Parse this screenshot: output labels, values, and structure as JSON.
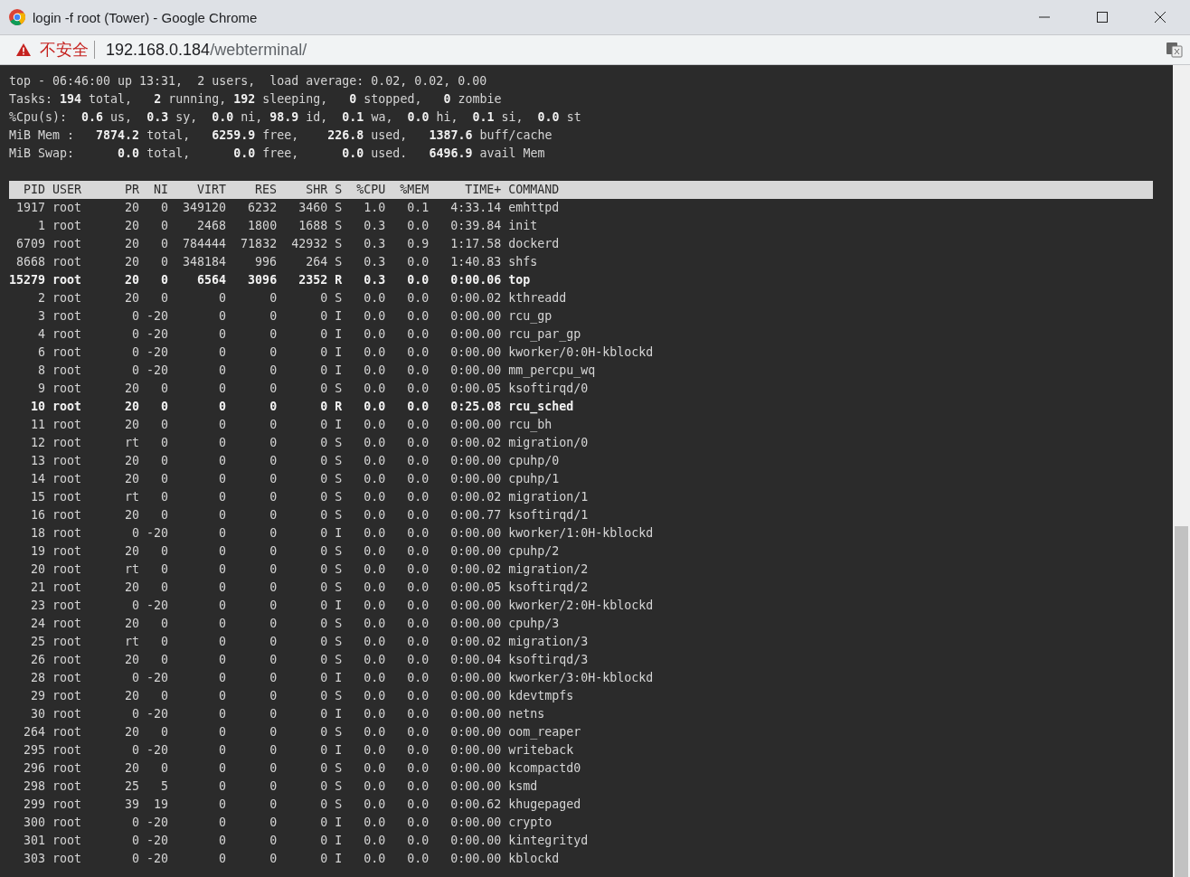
{
  "window": {
    "title": "login -f root (Tower) - Google Chrome"
  },
  "address_bar": {
    "security_label": "不安全",
    "host": "192.168.0.184",
    "path": "/webterminal/"
  },
  "terminal": {
    "summary": [
      "top - 06:46:00 up 13:31,  2 users,  load average: 0.02, 0.02, 0.00",
      "Tasks: **194** total,   **2** running, **192** sleeping,   **0** stopped,   **0** zombie",
      "%Cpu(s):  **0.6** us,  **0.3** sy,  **0.0** ni, **98.9** id,  **0.1** wa,  **0.0** hi,  **0.1** si,  **0.0** st",
      "MiB Mem :   **7874.2** total,   **6259.9** free,    **226.8** used,   **1387.6** buff/cache",
      "MiB Swap:      **0.0** total,      **0.0** free,      **0.0** used.   **6496.9** avail Mem"
    ],
    "columns": [
      "PID",
      "USER",
      "PR",
      "NI",
      "VIRT",
      "RES",
      "SHR",
      "S",
      "%CPU",
      "%MEM",
      "TIME+",
      "COMMAND"
    ],
    "processes": [
      {
        "cells": [
          "1917",
          "root",
          "20",
          "0",
          "349120",
          "6232",
          "3460",
          "S",
          "1.0",
          "0.1",
          "4:33.14",
          "emhttpd"
        ],
        "highlighted": false
      },
      {
        "cells": [
          "1",
          "root",
          "20",
          "0",
          "2468",
          "1800",
          "1688",
          "S",
          "0.3",
          "0.0",
          "0:39.84",
          "init"
        ],
        "highlighted": false
      },
      {
        "cells": [
          "6709",
          "root",
          "20",
          "0",
          "784444",
          "71832",
          "42932",
          "S",
          "0.3",
          "0.9",
          "1:17.58",
          "dockerd"
        ],
        "highlighted": false
      },
      {
        "cells": [
          "8668",
          "root",
          "20",
          "0",
          "348184",
          "996",
          "264",
          "S",
          "0.3",
          "0.0",
          "1:40.83",
          "shfs"
        ],
        "highlighted": false
      },
      {
        "cells": [
          "15279",
          "root",
          "20",
          "0",
          "6564",
          "3096",
          "2352",
          "R",
          "0.3",
          "0.0",
          "0:00.06",
          "top"
        ],
        "highlighted": true
      },
      {
        "cells": [
          "2",
          "root",
          "20",
          "0",
          "0",
          "0",
          "0",
          "S",
          "0.0",
          "0.0",
          "0:00.02",
          "kthreadd"
        ],
        "highlighted": false
      },
      {
        "cells": [
          "3",
          "root",
          "0",
          "-20",
          "0",
          "0",
          "0",
          "I",
          "0.0",
          "0.0",
          "0:00.00",
          "rcu_gp"
        ],
        "highlighted": false
      },
      {
        "cells": [
          "4",
          "root",
          "0",
          "-20",
          "0",
          "0",
          "0",
          "I",
          "0.0",
          "0.0",
          "0:00.00",
          "rcu_par_gp"
        ],
        "highlighted": false
      },
      {
        "cells": [
          "6",
          "root",
          "0",
          "-20",
          "0",
          "0",
          "0",
          "I",
          "0.0",
          "0.0",
          "0:00.00",
          "kworker/0:0H-kblockd"
        ],
        "highlighted": false
      },
      {
        "cells": [
          "8",
          "root",
          "0",
          "-20",
          "0",
          "0",
          "0",
          "I",
          "0.0",
          "0.0",
          "0:00.00",
          "mm_percpu_wq"
        ],
        "highlighted": false
      },
      {
        "cells": [
          "9",
          "root",
          "20",
          "0",
          "0",
          "0",
          "0",
          "S",
          "0.0",
          "0.0",
          "0:00.05",
          "ksoftirqd/0"
        ],
        "highlighted": false
      },
      {
        "cells": [
          "10",
          "root",
          "20",
          "0",
          "0",
          "0",
          "0",
          "R",
          "0.0",
          "0.0",
          "0:25.08",
          "rcu_sched"
        ],
        "highlighted": true
      },
      {
        "cells": [
          "11",
          "root",
          "20",
          "0",
          "0",
          "0",
          "0",
          "I",
          "0.0",
          "0.0",
          "0:00.00",
          "rcu_bh"
        ],
        "highlighted": false
      },
      {
        "cells": [
          "12",
          "root",
          "rt",
          "0",
          "0",
          "0",
          "0",
          "S",
          "0.0",
          "0.0",
          "0:00.02",
          "migration/0"
        ],
        "highlighted": false
      },
      {
        "cells": [
          "13",
          "root",
          "20",
          "0",
          "0",
          "0",
          "0",
          "S",
          "0.0",
          "0.0",
          "0:00.00",
          "cpuhp/0"
        ],
        "highlighted": false
      },
      {
        "cells": [
          "14",
          "root",
          "20",
          "0",
          "0",
          "0",
          "0",
          "S",
          "0.0",
          "0.0",
          "0:00.00",
          "cpuhp/1"
        ],
        "highlighted": false
      },
      {
        "cells": [
          "15",
          "root",
          "rt",
          "0",
          "0",
          "0",
          "0",
          "S",
          "0.0",
          "0.0",
          "0:00.02",
          "migration/1"
        ],
        "highlighted": false
      },
      {
        "cells": [
          "16",
          "root",
          "20",
          "0",
          "0",
          "0",
          "0",
          "S",
          "0.0",
          "0.0",
          "0:00.77",
          "ksoftirqd/1"
        ],
        "highlighted": false
      },
      {
        "cells": [
          "18",
          "root",
          "0",
          "-20",
          "0",
          "0",
          "0",
          "I",
          "0.0",
          "0.0",
          "0:00.00",
          "kworker/1:0H-kblockd"
        ],
        "highlighted": false
      },
      {
        "cells": [
          "19",
          "root",
          "20",
          "0",
          "0",
          "0",
          "0",
          "S",
          "0.0",
          "0.0",
          "0:00.00",
          "cpuhp/2"
        ],
        "highlighted": false
      },
      {
        "cells": [
          "20",
          "root",
          "rt",
          "0",
          "0",
          "0",
          "0",
          "S",
          "0.0",
          "0.0",
          "0:00.02",
          "migration/2"
        ],
        "highlighted": false
      },
      {
        "cells": [
          "21",
          "root",
          "20",
          "0",
          "0",
          "0",
          "0",
          "S",
          "0.0",
          "0.0",
          "0:00.05",
          "ksoftirqd/2"
        ],
        "highlighted": false
      },
      {
        "cells": [
          "23",
          "root",
          "0",
          "-20",
          "0",
          "0",
          "0",
          "I",
          "0.0",
          "0.0",
          "0:00.00",
          "kworker/2:0H-kblockd"
        ],
        "highlighted": false
      },
      {
        "cells": [
          "24",
          "root",
          "20",
          "0",
          "0",
          "0",
          "0",
          "S",
          "0.0",
          "0.0",
          "0:00.00",
          "cpuhp/3"
        ],
        "highlighted": false
      },
      {
        "cells": [
          "25",
          "root",
          "rt",
          "0",
          "0",
          "0",
          "0",
          "S",
          "0.0",
          "0.0",
          "0:00.02",
          "migration/3"
        ],
        "highlighted": false
      },
      {
        "cells": [
          "26",
          "root",
          "20",
          "0",
          "0",
          "0",
          "0",
          "S",
          "0.0",
          "0.0",
          "0:00.04",
          "ksoftirqd/3"
        ],
        "highlighted": false
      },
      {
        "cells": [
          "28",
          "root",
          "0",
          "-20",
          "0",
          "0",
          "0",
          "I",
          "0.0",
          "0.0",
          "0:00.00",
          "kworker/3:0H-kblockd"
        ],
        "highlighted": false
      },
      {
        "cells": [
          "29",
          "root",
          "20",
          "0",
          "0",
          "0",
          "0",
          "S",
          "0.0",
          "0.0",
          "0:00.00",
          "kdevtmpfs"
        ],
        "highlighted": false
      },
      {
        "cells": [
          "30",
          "root",
          "0",
          "-20",
          "0",
          "0",
          "0",
          "I",
          "0.0",
          "0.0",
          "0:00.00",
          "netns"
        ],
        "highlighted": false
      },
      {
        "cells": [
          "264",
          "root",
          "20",
          "0",
          "0",
          "0",
          "0",
          "S",
          "0.0",
          "0.0",
          "0:00.00",
          "oom_reaper"
        ],
        "highlighted": false
      },
      {
        "cells": [
          "295",
          "root",
          "0",
          "-20",
          "0",
          "0",
          "0",
          "I",
          "0.0",
          "0.0",
          "0:00.00",
          "writeback"
        ],
        "highlighted": false
      },
      {
        "cells": [
          "296",
          "root",
          "20",
          "0",
          "0",
          "0",
          "0",
          "S",
          "0.0",
          "0.0",
          "0:00.00",
          "kcompactd0"
        ],
        "highlighted": false
      },
      {
        "cells": [
          "298",
          "root",
          "25",
          "5",
          "0",
          "0",
          "0",
          "S",
          "0.0",
          "0.0",
          "0:00.00",
          "ksmd"
        ],
        "highlighted": false
      },
      {
        "cells": [
          "299",
          "root",
          "39",
          "19",
          "0",
          "0",
          "0",
          "S",
          "0.0",
          "0.0",
          "0:00.62",
          "khugepaged"
        ],
        "highlighted": false
      },
      {
        "cells": [
          "300",
          "root",
          "0",
          "-20",
          "0",
          "0",
          "0",
          "I",
          "0.0",
          "0.0",
          "0:00.00",
          "crypto"
        ],
        "highlighted": false
      },
      {
        "cells": [
          "301",
          "root",
          "0",
          "-20",
          "0",
          "0",
          "0",
          "I",
          "0.0",
          "0.0",
          "0:00.00",
          "kintegrityd"
        ],
        "highlighted": false
      },
      {
        "cells": [
          "303",
          "root",
          "0",
          "-20",
          "0",
          "0",
          "0",
          "I",
          "0.0",
          "0.0",
          "0:00.00",
          "kblockd"
        ],
        "highlighted": false
      }
    ]
  }
}
